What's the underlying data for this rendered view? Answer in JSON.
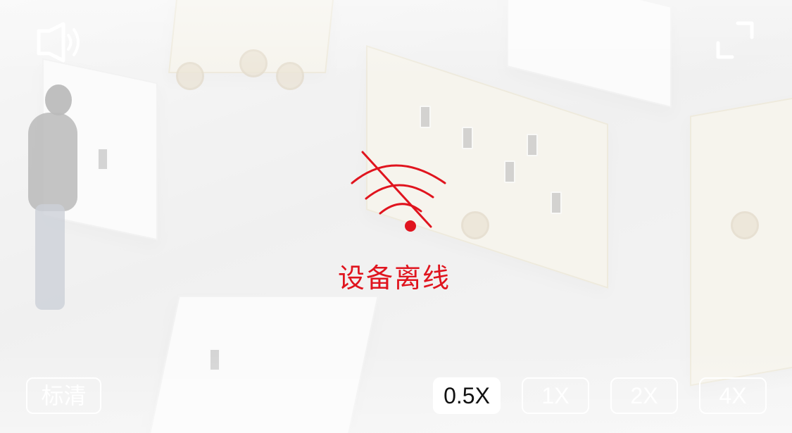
{
  "controls": {
    "volume_icon": "speaker-icon",
    "fullscreen_icon": "exit-fullscreen-icon",
    "quality_label": "标清",
    "speeds": [
      "0.5X",
      "1X",
      "2X",
      "4X"
    ],
    "active_speed": "0.5X"
  },
  "status": {
    "icon": "wifi-off-icon",
    "text": "设备离线",
    "color": "#e0141e"
  },
  "colors": {
    "overlay": "#ffffff",
    "text_light": "#ffffff",
    "accent": "#e0141e"
  }
}
